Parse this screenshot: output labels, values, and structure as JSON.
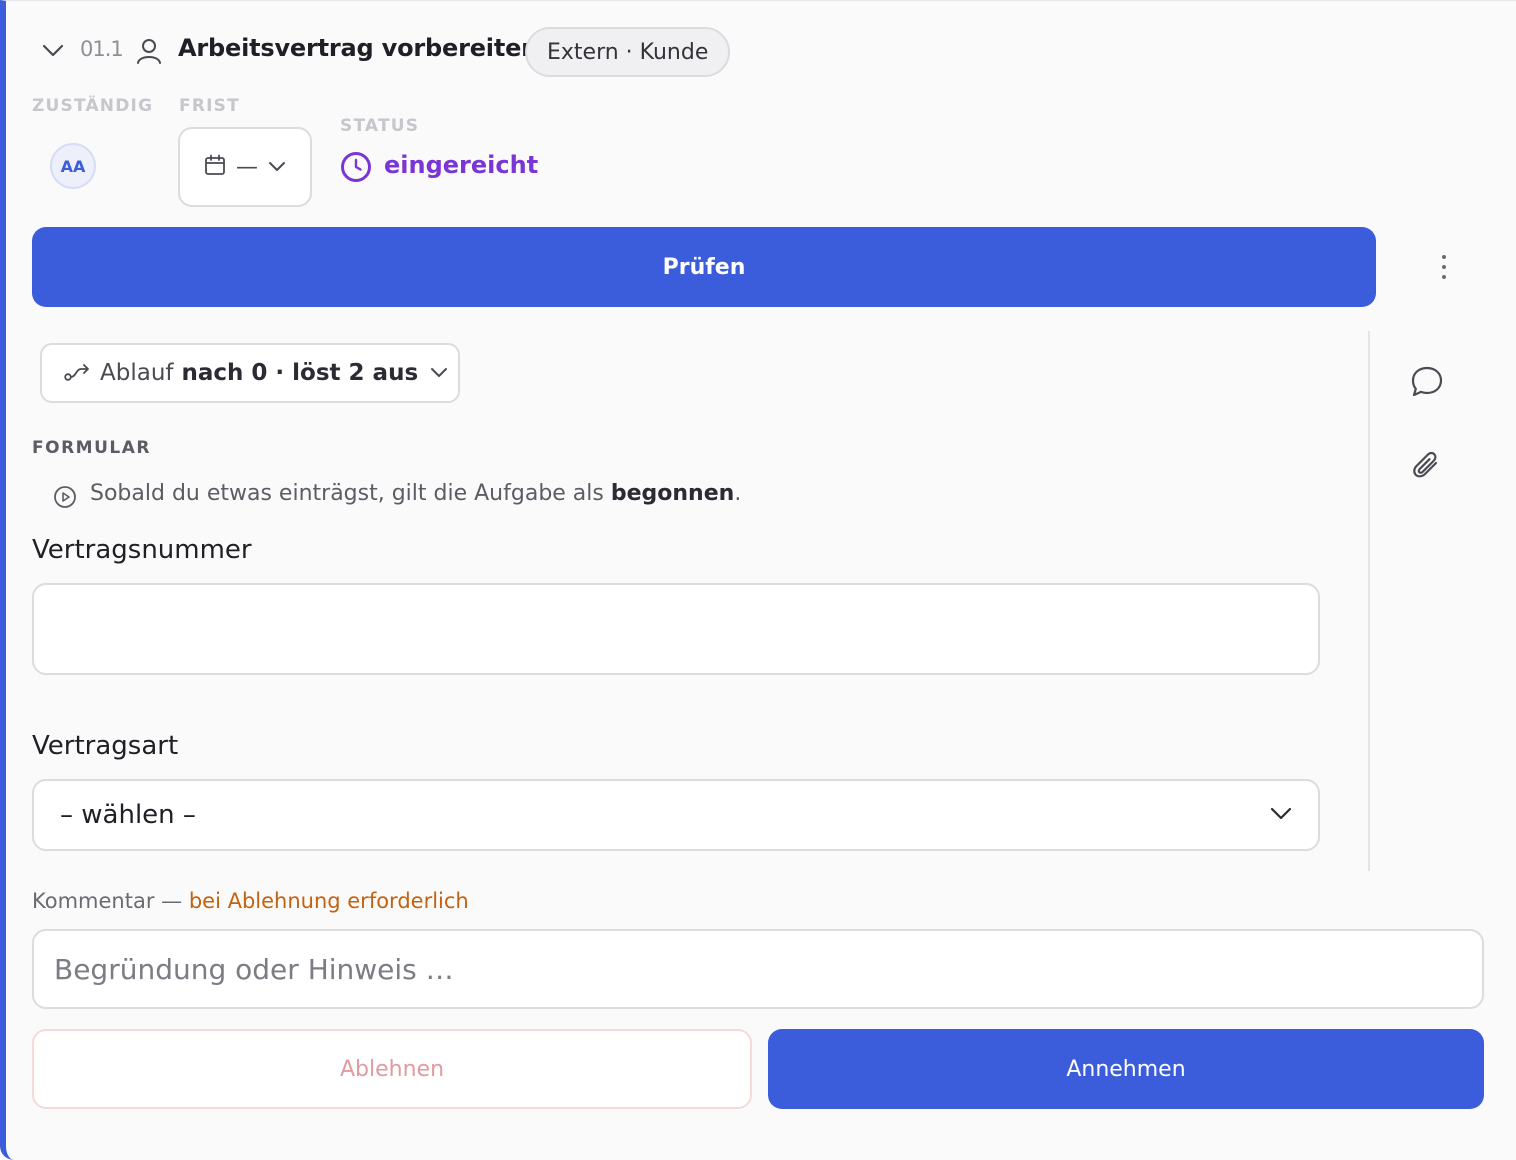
{
  "task": {
    "number": "01.1",
    "title": "Arbeitsvertrag vorbereiten",
    "audience_badge": "Extern · Kunde",
    "icons": {
      "collapse": "chevron-down-icon",
      "assignee_type": "person-icon"
    }
  },
  "meta": {
    "assignee_label": "ZUSTÄNDIG",
    "assignee_initials": "AA",
    "due_label": "FRIST",
    "due_value": "—",
    "status_label": "STATUS",
    "status_value": "eingereicht",
    "status_color": "#7a35d6"
  },
  "primary_action": {
    "label": "Prüfen"
  },
  "flow": {
    "label": "Ablauf",
    "value": "nach 0 · löst 2 aus"
  },
  "form": {
    "section_label": "FORMULAR",
    "hint_text": "Sobald du etwas einträgst, gilt die Aufgabe als ",
    "hint_emphasis": "begonnen",
    "hint_end": ".",
    "fields": [
      {
        "label": "Vertragsnummer",
        "value": ""
      },
      {
        "label": "Vertragsart",
        "value": "– wählen –"
      }
    ]
  },
  "comment": {
    "label": "Kommentar — ",
    "requirement": "bei Ablehnung erforderlich",
    "placeholder": "Begründung oder Hinweis …",
    "value": ""
  },
  "decision": {
    "reject_label": "Ablehnen",
    "accept_label": "Annehmen"
  },
  "theme": {
    "accent": "#3c5ddb",
    "status": "#7a35d6",
    "warning": "#c5620f",
    "reject_text": "#e19aa0"
  }
}
